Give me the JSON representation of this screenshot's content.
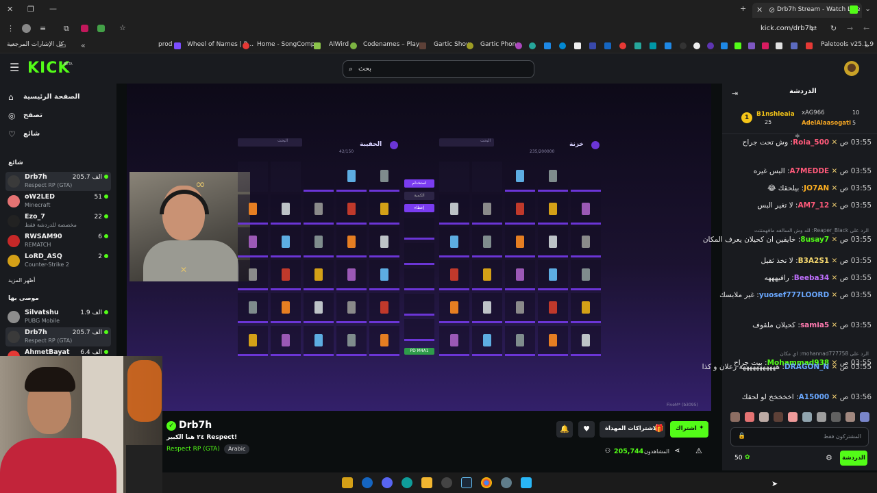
{
  "browser": {
    "tab_title": "Drb7h Stream - Watch Live",
    "url": "kick.com/drb7h",
    "bookmarks_folder": "كل الإشارات المرجعية",
    "bookmarks": [
      "prod",
      "Wheel of Names | R...",
      "Home - SongComp...",
      "AlWird",
      "Codenames – Play...",
      "Gartic Show",
      "Gartic Phone",
      "Paletools v25.1.9"
    ]
  },
  "kick": {
    "logo": "KICK",
    "logo_badge": "BETA",
    "search_placeholder": "بحث"
  },
  "sidebar": {
    "nav": [
      {
        "label": "الصفحة الرئيسية",
        "icon": "home-icon"
      },
      {
        "label": "تصفح",
        "icon": "compass-icon"
      },
      {
        "label": "شائع",
        "icon": "heart-icon"
      }
    ],
    "following_header": "شائع",
    "following": [
      {
        "name": "Drb7h",
        "category": "Respect RP (GTA)",
        "viewers": "205.7 الف"
      },
      {
        "name": "oW2LED",
        "category": "Minecraft",
        "viewers": "51"
      },
      {
        "name": "Ezo_7",
        "category": "مخصصة للدردشة فقط",
        "viewers": "22"
      },
      {
        "name": "RWSAM90",
        "category": "REMATCH",
        "viewers": "6"
      },
      {
        "name": "LoRD_ASQ",
        "category": "Counter-Strike 2",
        "viewers": "2"
      }
    ],
    "show_more": "أظهر المزيد",
    "recommended_header": "موصى بها",
    "recommended": [
      {
        "name": "Silvatshu",
        "category": "PUBG Mobile",
        "viewers": "1.9 الف"
      },
      {
        "name": "Drb7h",
        "category": "Respect RP (GTA)",
        "viewers": "205.7 الف"
      },
      {
        "name": "AhmetBayat",
        "category": "",
        "viewers": "6.4 الف"
      }
    ]
  },
  "game": {
    "left_title": "الحقيبة",
    "left_count": "42/150",
    "right_title": "خزنة",
    "right_count": "235/200000",
    "search_placeholder": "البحث",
    "use_button": "استخدام",
    "qty_label": "الكمية",
    "give_button": "إعطاء",
    "weapon_label": "PD M4A1",
    "watermark": "FiveM* (b3095)"
  },
  "stream": {
    "streamer": "Drb7h",
    "title": "!Respect ٢٤ هنا الكبير",
    "category": "Respect RP (GTA)",
    "tag": "Arabic",
    "subscribe_label": "اشتراك",
    "gift_label": "الاشتراكات المهداة",
    "viewers": "205,744",
    "viewers_label": "المشاهدون"
  },
  "chat": {
    "title": "الدردشة",
    "leaders": [
      {
        "name": "B1nshleaia",
        "value": "25",
        "rank": "1"
      },
      {
        "name": "xAG966",
        "value": "10"
      },
      {
        "name": "AdelAlaasogati",
        "value": "5"
      }
    ],
    "messages": [
      {
        "time": "03:55 ص",
        "user": "Roia_500",
        "text": "وش تحت جراح",
        "color": "#ff5a7a"
      },
      {
        "time": "03:55 ص",
        "user": "A7MEDDE",
        "text": "البس غيره",
        "color": "#ff5a7a"
      },
      {
        "time": "03:55 ص",
        "user": "JO7AN",
        "text": "بيلحقك 😂",
        "color": "#ffb020"
      },
      {
        "time": "03:55 ص",
        "user": "AM7_12",
        "text": "لا تغير البس",
        "color": "#ff5a7a"
      },
      {
        "time": "03:55 ص",
        "user": "8usay7",
        "text": "خايفين ان كحيلان يعرف المكان",
        "color": "#53fc18",
        "reply": "الرد على Reaper_Black: لله وش السالفه ماقهمتتت"
      },
      {
        "time": "03:55 ص",
        "user": "B3A2S1",
        "text": "لا تخذ ثقيل",
        "color": "#f5d76e"
      },
      {
        "time": "03:55 ص",
        "user": "Beeba34",
        "text": "رافيهههه",
        "color": "#c070ff"
      },
      {
        "time": "03:55 ص",
        "user": "yuosef777LOORD",
        "text": "غير ملابسك",
        "color": "#6aa8ff"
      },
      {
        "time": "03:55 ص",
        "user": "samia5",
        "text": "كحيلان ملقوف",
        "color": "#ff7ab0"
      },
      {
        "time": "03:55 ص",
        "user": "Mohammad938",
        "text": "بيت جراح",
        "color": "#53fc18",
        "reply": "الرد على mohannad777758: اي مكان"
      },
      {
        "time": "03:55 ص",
        "user": "DRAGON_N",
        "text": "هههههههههههه زعلان و كذا",
        "color": "#6aa8ff"
      },
      {
        "time": "03:56 ص",
        "user": "A15000",
        "text": "اخخخخخ لو لحقك",
        "color": "#6aa8ff"
      }
    ],
    "input_placeholder": "المشتركون فقط",
    "points": "50",
    "send_label": "الدردشة"
  },
  "colors": {
    "accent": "#53fc18",
    "bg": "#0b0e0f",
    "panel": "#191b1f",
    "game_purple": "#6b35d6"
  }
}
